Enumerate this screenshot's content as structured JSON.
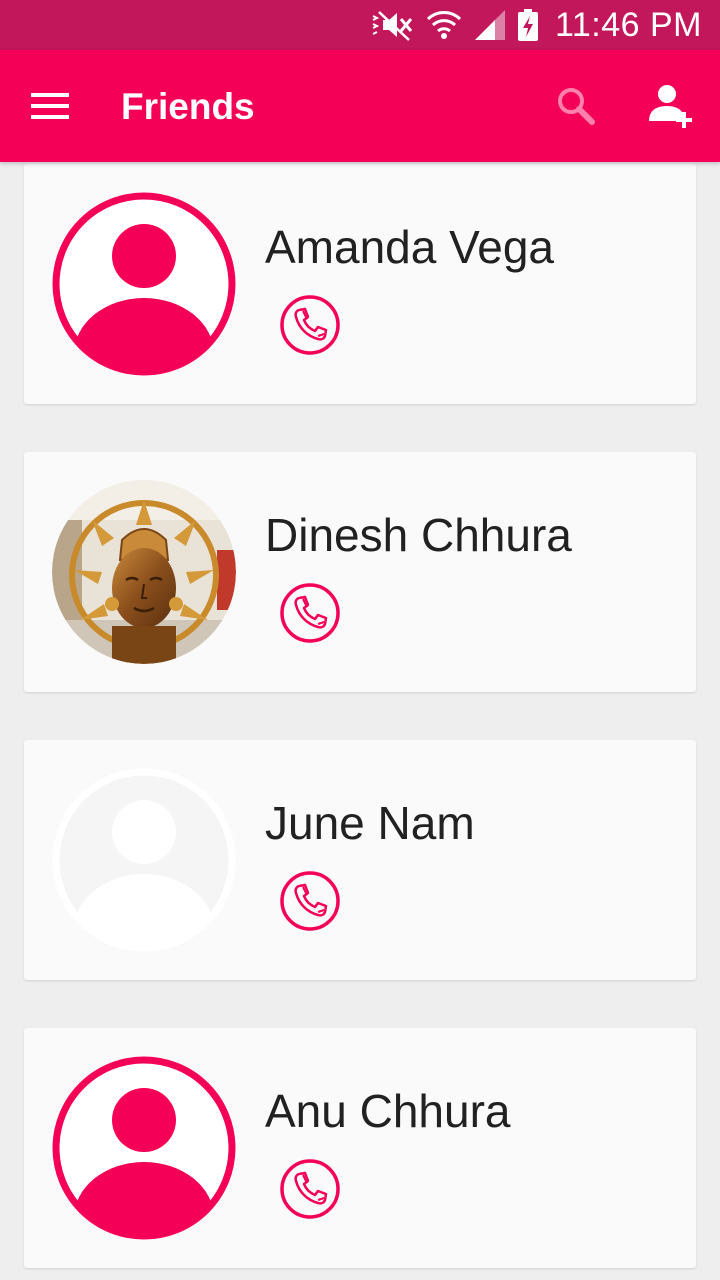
{
  "status_bar": {
    "time": "11:46 PM",
    "icons": [
      "mute-icon",
      "wifi-icon",
      "signal-icon",
      "battery-charging-icon"
    ]
  },
  "app_bar": {
    "title": "Friends",
    "icons": [
      "menu-icon",
      "search-icon",
      "add-person-icon"
    ]
  },
  "friends": [
    {
      "name": "Amanda Vega",
      "avatar": "default-avatar-icon"
    },
    {
      "name": "Dinesh Chhura",
      "avatar": "photo"
    },
    {
      "name": "June Nam",
      "avatar": "default-avatar-icon"
    },
    {
      "name": "Anu Chhura",
      "avatar": "default-avatar-icon"
    }
  ],
  "colors": {
    "status_bar": "#c2185b",
    "app_bar": "#f50057",
    "accent": "#f50057",
    "background": "#eeeeee",
    "card": "#fafafa",
    "text": "#212121"
  }
}
